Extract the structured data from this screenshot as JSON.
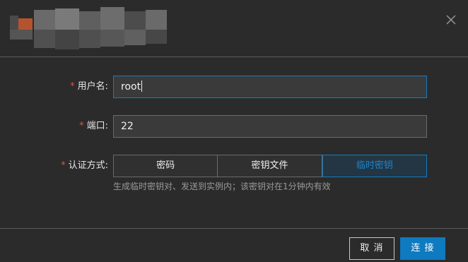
{
  "dialog": {
    "close_icon": "close-icon"
  },
  "form": {
    "username": {
      "required_mark": "*",
      "label": "用户名:",
      "value": "root"
    },
    "port": {
      "required_mark": "*",
      "label": "端口:",
      "value": "22"
    },
    "auth": {
      "required_mark": "*",
      "label": "认证方式:",
      "options": [
        "密码",
        "密钥文件",
        "临时密钥"
      ],
      "selected": "临时密钥",
      "hint": "生成临时密钥对、发送到实例内；该密钥对在1分钟内有效"
    }
  },
  "footer": {
    "cancel_label": "取 消",
    "connect_label": "连 接"
  },
  "colors": {
    "accent": "#0e7ac0",
    "required": "#e0523e",
    "background": "#2b2b2b"
  }
}
